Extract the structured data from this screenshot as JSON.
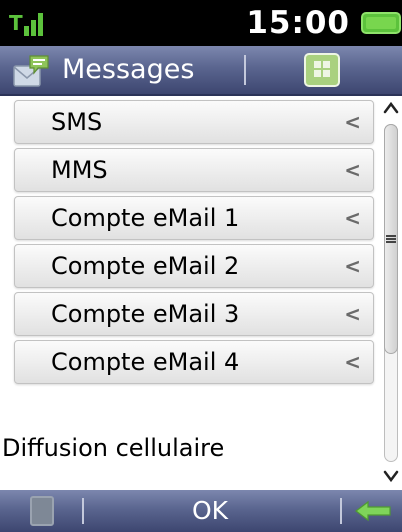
{
  "status_bar": {
    "time": "15:00",
    "signal_icon": "signal-strength-icon",
    "battery_icon": "battery-icon"
  },
  "title_bar": {
    "title": "Messages",
    "app_icon": "messages-app-icon",
    "menu_icon": "grid-menu-icon"
  },
  "list": {
    "items": [
      {
        "label": "SMS"
      },
      {
        "label": "MMS"
      },
      {
        "label": "Compte eMail 1"
      },
      {
        "label": "Compte eMail 2"
      },
      {
        "label": "Compte eMail 3"
      },
      {
        "label": "Compte eMail 4"
      }
    ],
    "chevron": "<",
    "plain_item": "Diffusion cellulaire"
  },
  "softkeys": {
    "center": "OK",
    "left_icon": "left-softkey-icon",
    "right_icon": "back-arrow-icon"
  },
  "colors": {
    "bar_gradient_top": "#7c87ae",
    "bar_gradient_bottom": "#3d4670",
    "signal_green": "#5cc23c",
    "grid_button": "#a9d17f"
  }
}
